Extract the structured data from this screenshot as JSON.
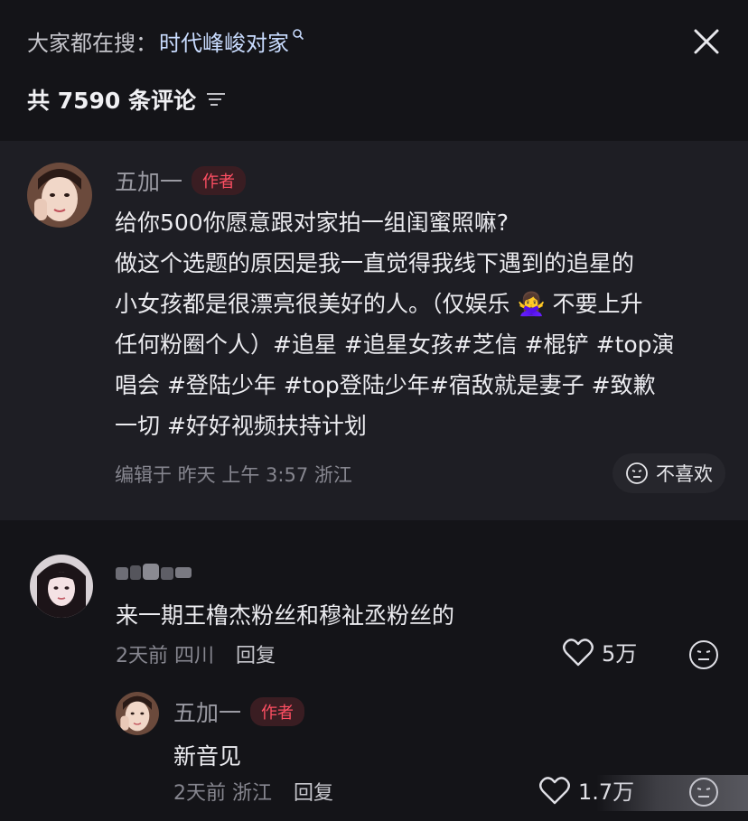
{
  "header": {
    "search_prefix": "大家都在搜：",
    "search_keyword": "时代峰峻对家",
    "comment_count": "共 7590 条评论"
  },
  "post": {
    "author": "五加一",
    "author_tag": "作者",
    "text_lines": [
      "给你500你愿意跟对家拍一组闺蜜照嘛?",
      "做这个选题的原因是我一直觉得我线下遇到的追星的",
      "小女孩都是很漂亮很美好的人。（仅娱乐 🙅‍♀️ 不要上升",
      "任何粉圈个人）#追星 #追星女孩#芝信 #棍铲 #top演",
      "唱会 #登陆少年 #top登陆少年#宿敌就是妻子 #致歉",
      "一切 #好好视频扶持计划"
    ],
    "meta": "编辑于  昨天 上午 3:57  浙江",
    "dislike_label": "不喜欢"
  },
  "comment": {
    "text": "来一期王橹杰粉丝和穆祉丞粉丝的",
    "time_location": "2天前 四川",
    "reply_label": "回复",
    "likes": "5万"
  },
  "reply": {
    "author": "五加一",
    "author_tag": "作者",
    "text": "新音见",
    "time_location": "2天前 浙江",
    "reply_label": "回复",
    "likes": "1.7万"
  },
  "colors": {
    "background": "#141418",
    "post_background": "#1e1e24",
    "author_tag_text": "#ff4f63",
    "keyword": "#c9dcff"
  },
  "icons": [
    "search-icon",
    "close-icon",
    "sort-icon",
    "dislike-face-icon",
    "heart-icon",
    "neutral-face-icon"
  ]
}
